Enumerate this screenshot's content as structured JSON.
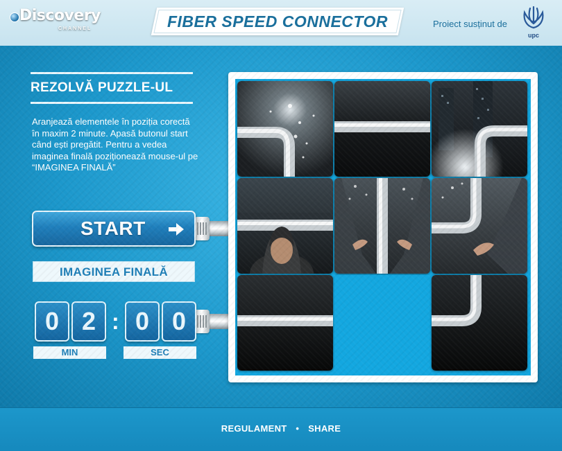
{
  "header": {
    "logo_main": "Discovery",
    "logo_sub": "CHANNEL",
    "title": "FIBER SPEED CONNECTOR",
    "sponsor_text": "Proiect susținut de",
    "sponsor_logo_label": "upc"
  },
  "panel": {
    "title": "REZOLVĂ PUZZLE-UL",
    "instructions": "Aranjează elementele în poziția corectă în maxim 2 minute. Apasă butonul start când ești pregătit. Pentru a vedea imaginea finală poziționează mouse-ul pe “IMAGINEA FINALĂ”",
    "start_label": "START",
    "start_icon": "arrow-right-icon",
    "final_image_label": "IMAGINEA FINALĂ"
  },
  "timer": {
    "min_digits": [
      "0",
      "2"
    ],
    "sec_digits": [
      "0",
      "0"
    ],
    "separator": ":",
    "min_label": "MIN",
    "sec_label": "SEC"
  },
  "puzzle": {
    "grid": "3x3",
    "empty_slot": 7,
    "tiles": [
      "sparks-pipe-corner",
      "dark-pipe-horizontal",
      "city-sparks-pipe-corner",
      "man-hood-pipe",
      "hands-pipe-vertical",
      "hands-pipe-elbow",
      "dark-pipe-horizontal-2",
      "empty",
      "dark-pipe-elbow"
    ]
  },
  "footer": {
    "links": [
      "REGULAMENT",
      "SHARE"
    ],
    "separator": "•"
  },
  "colors": {
    "accent": "#1a8fc0",
    "board_empty": "#13a7e0",
    "title_text": "#1a6f9c"
  }
}
